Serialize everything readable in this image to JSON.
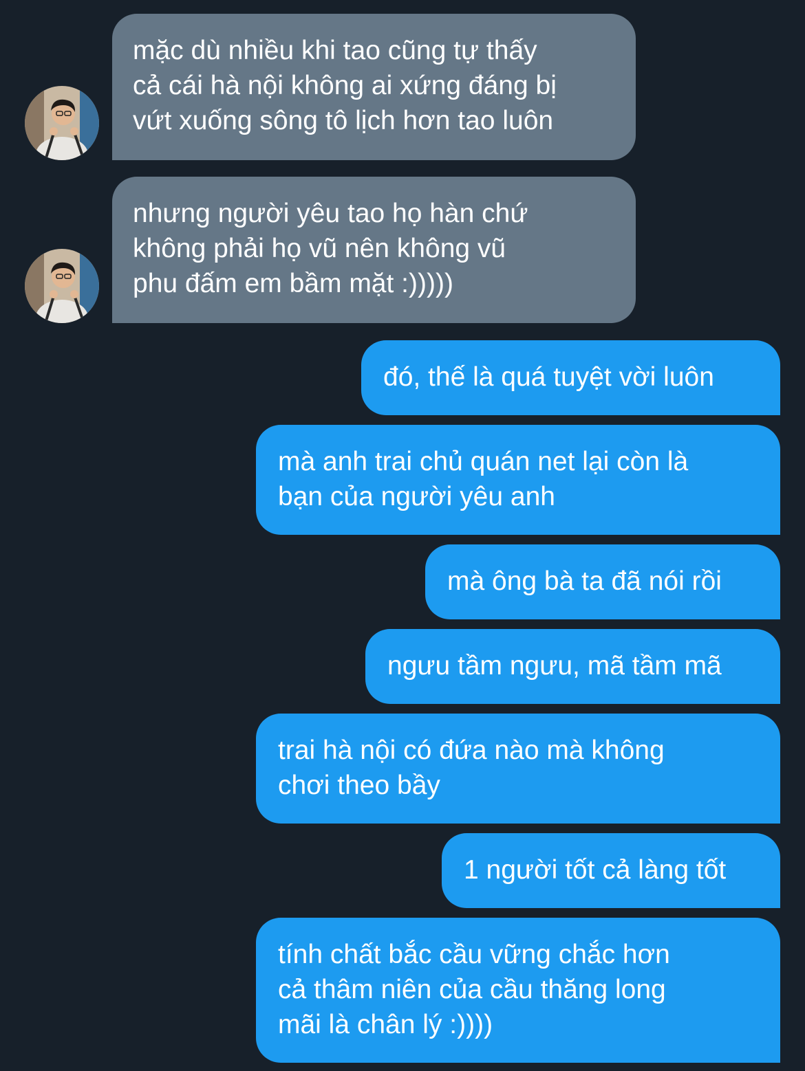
{
  "conversation": {
    "messages": [
      {
        "direction": "received",
        "text": "mặc dù nhiều khi tao cũng tự thấy\ncả cái hà nội không ai xứng đáng bị\nvứt xuống sông tô lịch hơn tao luôn"
      },
      {
        "direction": "received",
        "text": "nhưng người yêu tao họ hàn chứ\nkhông phải họ vũ nên không vũ\nphu đấm em bầm mặt :)))))"
      },
      {
        "direction": "sent",
        "text": "đó, thế là quá tuyệt vời luôn"
      },
      {
        "direction": "sent",
        "text": "mà anh trai chủ quán net lại còn là\nbạn của người yêu anh"
      },
      {
        "direction": "sent",
        "text": "mà ông bà ta đã nói rồi"
      },
      {
        "direction": "sent",
        "text": "ngưu tầm ngưu, mã tầm mã"
      },
      {
        "direction": "sent",
        "text": "trai hà nội có đứa nào mà không\nchơi theo bầy"
      },
      {
        "direction": "sent",
        "text": "1 người tốt cả làng tốt"
      },
      {
        "direction": "sent",
        "text": "tính chất bắc cầu vững chắc hơn\ncả thâm niên của cầu thăng long\nmãi là chân lý :))))"
      }
    ]
  },
  "colors": {
    "background": "#17202a",
    "received_bubble": "#657787",
    "sent_bubble": "#1d9bf0",
    "text": "#ffffff"
  },
  "icons": {
    "avatar": "user-avatar-photo"
  }
}
